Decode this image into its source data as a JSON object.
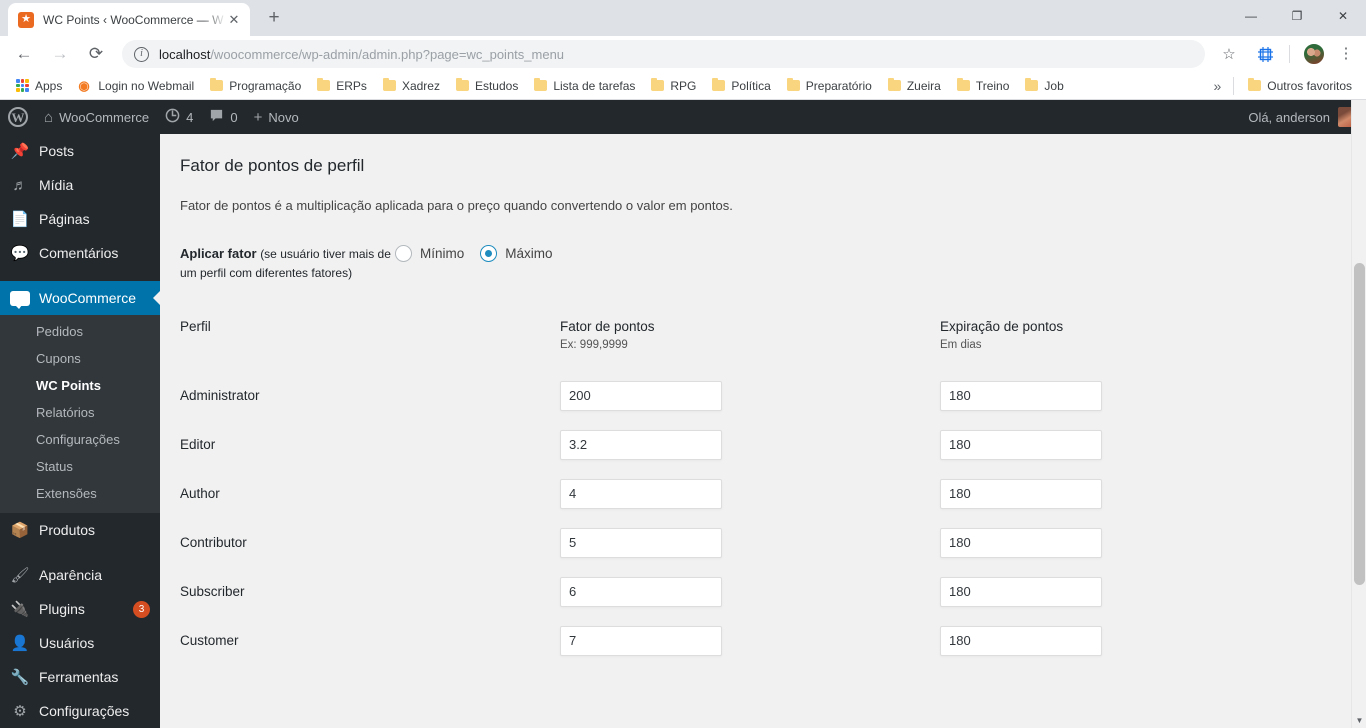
{
  "browser": {
    "tab": {
      "favicon": "woocommerce-favicon",
      "title": "WC Points ‹ WooCommerce — W",
      "close_label": "✕"
    },
    "new_tab_label": "+",
    "window_controls": {
      "minimize": "—",
      "maximize": "❐",
      "close": "✕"
    },
    "nav": {
      "back": "←",
      "forward": "→",
      "reload": "⟳"
    },
    "omnibox": {
      "info_icon": "ⓘ",
      "url_host": "localhost",
      "url_path": "/woocommerce/wp-admin/admin.php?page=wc_points_menu",
      "star_icon": "☆"
    },
    "toolbar_right": {
      "extension_icon": "extension-icon",
      "profile_avatar": "user-avatar",
      "menu_icon": "⋮"
    },
    "bookmarks": [
      {
        "label": "Apps",
        "icon": "apps-grid-icon"
      },
      {
        "label": "Login no Webmail",
        "icon": "cpanel-icon"
      },
      {
        "label": "Programação",
        "icon": "folder-icon"
      },
      {
        "label": "ERPs",
        "icon": "folder-icon"
      },
      {
        "label": "Xadrez",
        "icon": "folder-icon"
      },
      {
        "label": "Estudos",
        "icon": "folder-icon"
      },
      {
        "label": "Lista de tarefas",
        "icon": "folder-icon"
      },
      {
        "label": "RPG",
        "icon": "folder-icon"
      },
      {
        "label": "Política",
        "icon": "folder-icon"
      },
      {
        "label": "Preparatório",
        "icon": "folder-icon"
      },
      {
        "label": "Zueira",
        "icon": "folder-icon"
      },
      {
        "label": "Treino",
        "icon": "folder-icon"
      },
      {
        "label": "Job",
        "icon": "folder-icon"
      }
    ],
    "bookmarks_overflow": "»",
    "other_bookmarks": {
      "label": "Outros favoritos",
      "icon": "folder-icon"
    }
  },
  "adminbar": {
    "wp_logo": "W",
    "site_name": "WooCommerce",
    "site_icon": "⌂",
    "updates": {
      "icon": "↻",
      "count": "4"
    },
    "comments": {
      "icon": "💬",
      "count": "0"
    },
    "new": {
      "icon": "+",
      "label": "Novo"
    },
    "greeting": "Olá, anderson",
    "avatar": "user-avatar"
  },
  "sidebar": {
    "items": [
      {
        "label": "Posts",
        "icon": "pin-icon",
        "state": "normal"
      },
      {
        "label": "Mídia",
        "icon": "media-icon",
        "state": "normal"
      },
      {
        "label": "Páginas",
        "icon": "pages-icon",
        "state": "normal"
      },
      {
        "label": "Comentários",
        "icon": "comments-icon",
        "state": "normal"
      },
      {
        "label": "WooCommerce",
        "icon": "woocommerce-icon",
        "state": "current"
      },
      {
        "label": "Produtos",
        "icon": "products-icon",
        "state": "normal"
      },
      {
        "label": "Aparência",
        "icon": "appearance-icon",
        "state": "normal"
      },
      {
        "label": "Plugins",
        "icon": "plugins-icon",
        "state": "normal",
        "badge": "3"
      },
      {
        "label": "Usuários",
        "icon": "users-icon",
        "state": "normal"
      },
      {
        "label": "Ferramentas",
        "icon": "tools-icon",
        "state": "normal"
      },
      {
        "label": "Configurações",
        "icon": "settings-icon",
        "state": "normal"
      }
    ],
    "submenu": [
      {
        "label": "Pedidos",
        "state": "normal"
      },
      {
        "label": "Cupons",
        "state": "normal"
      },
      {
        "label": "WC Points",
        "state": "current"
      },
      {
        "label": "Relatórios",
        "state": "normal"
      },
      {
        "label": "Configurações",
        "state": "normal"
      },
      {
        "label": "Status",
        "state": "normal"
      },
      {
        "label": "Extensões",
        "state": "normal"
      }
    ]
  },
  "main": {
    "title": "Fator de pontos de perfil",
    "description": "Fator de pontos é a multiplicação aplicada para o preço quando convertendo o valor em pontos.",
    "apply_factor": {
      "label_strong": "Aplicar fator ",
      "label_note": "(se usuário tiver mais de um perfil com diferentes fatores)",
      "options": [
        {
          "label": "Mínimo",
          "checked": false
        },
        {
          "label": "Máximo",
          "checked": true
        }
      ]
    },
    "table": {
      "headers": [
        {
          "title": "Perfil",
          "sub": ""
        },
        {
          "title": "Fator de pontos",
          "sub": "Ex: 999,9999"
        },
        {
          "title": "Expiração de pontos",
          "sub": "Em dias"
        }
      ],
      "rows": [
        {
          "role": "Administrator",
          "factor": "200",
          "expiration": "180"
        },
        {
          "role": "Editor",
          "factor": "3.2",
          "expiration": "180"
        },
        {
          "role": "Author",
          "factor": "4",
          "expiration": "180"
        },
        {
          "role": "Contributor",
          "factor": "5",
          "expiration": "180"
        },
        {
          "role": "Subscriber",
          "factor": "6",
          "expiration": "180"
        },
        {
          "role": "Customer",
          "factor": "7",
          "expiration": "180"
        }
      ]
    }
  },
  "colors": {
    "wp_admin_dark": "#23282d",
    "wp_submenu_dark": "#32373c",
    "wp_current_blue": "#0073aa",
    "wp_content_bg": "#f1f1f1",
    "radio_accent": "#1e8cbe",
    "badge_orange": "#d54e21",
    "chrome_tabstrip": "#dee1e6"
  }
}
